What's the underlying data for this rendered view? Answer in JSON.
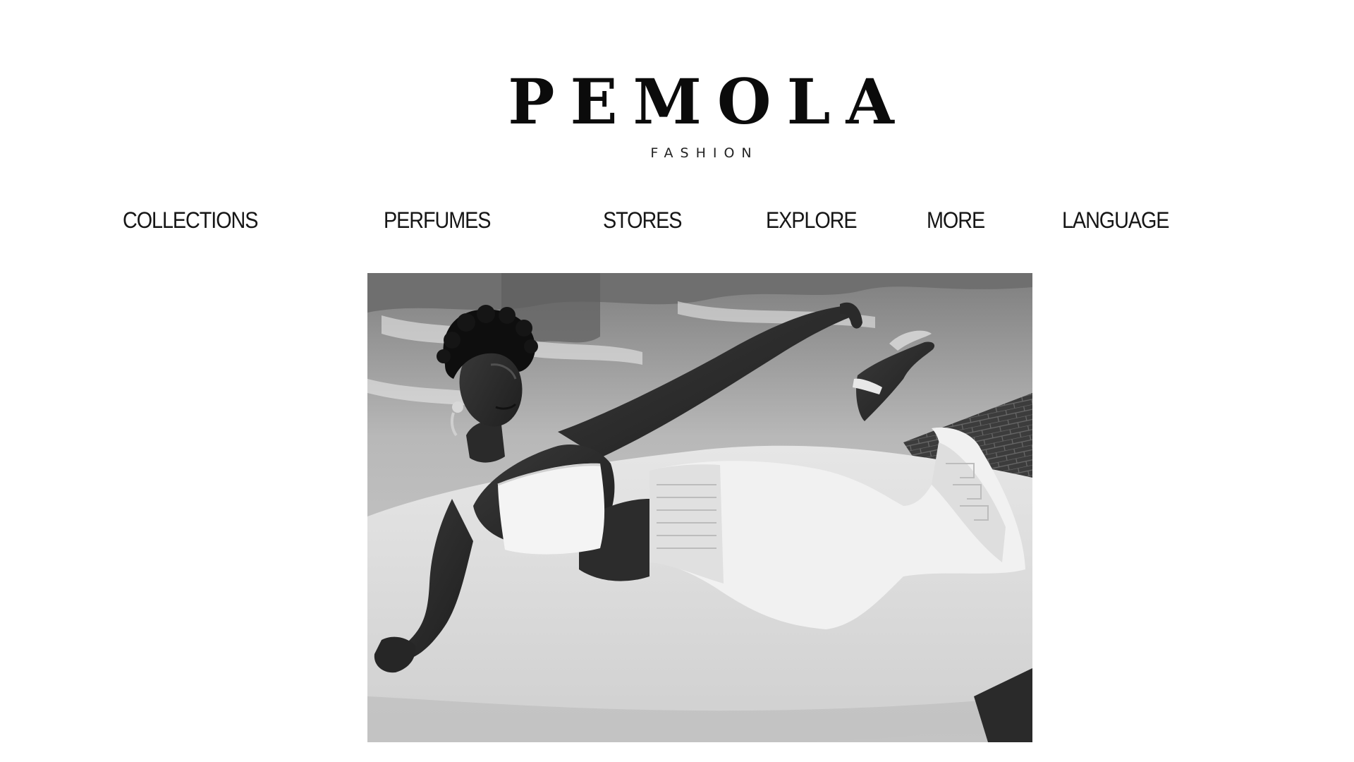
{
  "brand": {
    "name": "PEMOLA",
    "tagline": "FASHION"
  },
  "nav": {
    "items": [
      {
        "label": "COLLECTIONS"
      },
      {
        "label": "PERFUMES"
      },
      {
        "label": "STORES"
      },
      {
        "label": "EXPLORE"
      },
      {
        "label": "MORE"
      },
      {
        "label": "LANGUAGE"
      }
    ]
  },
  "hero": {
    "style": "black-and-white photograph",
    "colors": {
      "water": "#9a9a9a",
      "cushion": "#d9d9d9",
      "skin": "#2e2e2e",
      "garment": "#f3f3f3",
      "brick": "#3c3c3c"
    }
  },
  "colors": {
    "background": "#ffffff",
    "text": "#111111"
  }
}
